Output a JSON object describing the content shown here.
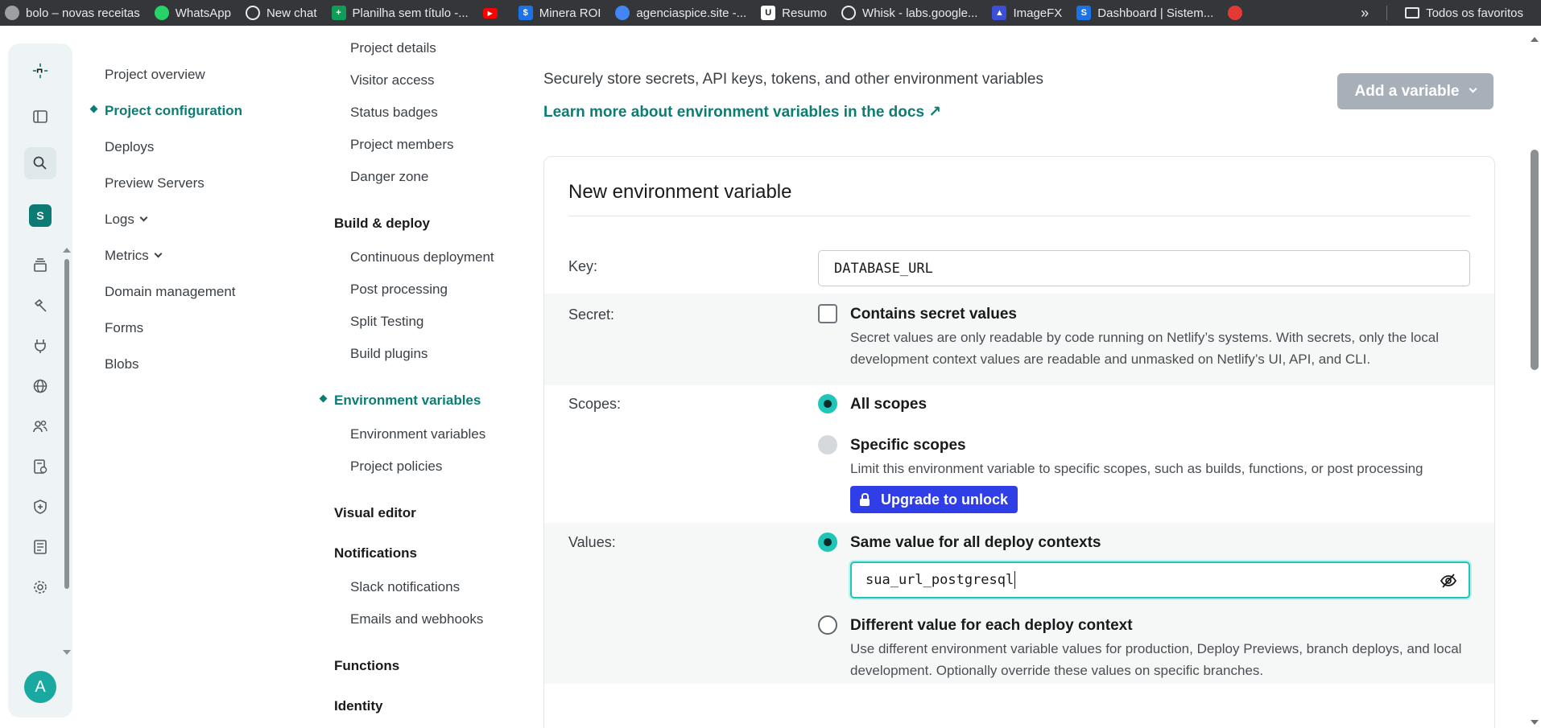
{
  "bookmarks": [
    {
      "label": "bolo – novas receitas",
      "icon": "globe-icon",
      "color": "#9aa0a6"
    },
    {
      "label": "WhatsApp",
      "icon": "whatsapp-icon",
      "color": "#25d366"
    },
    {
      "label": "New chat",
      "icon": "openai-icon",
      "color": "#35363a"
    },
    {
      "label": "Planilha sem título -...",
      "icon": "sheets-icon",
      "color": "#0f9d58"
    },
    {
      "label": "",
      "icon": "youtube-icon",
      "color": "#ff0000"
    },
    {
      "label": "Minera ROI",
      "icon": "minera-icon",
      "color": "#1a73e8"
    },
    {
      "label": "agenciaspice.site -...",
      "icon": "site-icon",
      "color": "#4285f4"
    },
    {
      "label": "Resumo",
      "icon": "resumo-icon",
      "color": "#202124"
    },
    {
      "label": "Whisk - labs.google...",
      "icon": "whisk-icon",
      "color": "#35363a"
    },
    {
      "label": "ImageFX",
      "icon": "imagefx-icon",
      "color": "#3c4fd8"
    },
    {
      "label": "Dashboard | Sistem...",
      "icon": "dashboard-icon",
      "color": "#1a73e8"
    },
    {
      "label": "",
      "icon": "app-icon",
      "color": "#e53935"
    }
  ],
  "bookmarks_folder": "Todos os favoritos",
  "rail": {
    "team_initial": "S",
    "avatar_initial": "A"
  },
  "nav1": {
    "items": [
      {
        "label": "Project overview"
      },
      {
        "label": "Project configuration"
      },
      {
        "label": "Deploys"
      },
      {
        "label": "Preview Servers"
      },
      {
        "label": "Logs"
      },
      {
        "label": "Metrics"
      },
      {
        "label": "Domain management"
      },
      {
        "label": "Forms"
      },
      {
        "label": "Blobs"
      }
    ]
  },
  "nav2": {
    "general_items": [
      "Project details",
      "Visitor access",
      "Status badges",
      "Project members",
      "Danger zone"
    ],
    "build_deploy": "Build & deploy",
    "build_items": [
      "Continuous deployment",
      "Post processing",
      "Split Testing",
      "Build plugins"
    ],
    "env_vars": "Environment variables",
    "env_items": [
      "Environment variables",
      "Project policies"
    ],
    "visual_editor": "Visual editor",
    "notifications": "Notifications",
    "notification_items": [
      "Slack notifications",
      "Emails and webhooks"
    ],
    "functions": "Functions",
    "identity": "Identity"
  },
  "main": {
    "intro": "Securely store secrets, API keys, tokens, and other environment variables",
    "learn_link": "Learn more about environment variables in the docs ↗",
    "add_variable": "Add a variable",
    "card_title": "New environment variable",
    "key_label": "Key:",
    "key_value": "DATABASE_URL",
    "secret_label": "Secret:",
    "secret_option": "Contains secret values",
    "secret_desc": "Secret values are only readable by code running on Netlify’s systems. With secrets, only the local development context values are readable and unmasked on Netlify’s UI, API, and CLI.",
    "scopes_label": "Scopes:",
    "all_scopes": "All scopes",
    "specific_scopes": "Specific scopes",
    "specific_desc": "Limit this environment variable to specific scopes, such as builds, functions, or post processing",
    "upgrade": "Upgrade to unlock",
    "values_label": "Values:",
    "same_value": "Same value for all deploy contexts",
    "value_input": "sua_url_postgresql",
    "different_value": "Different value for each deploy context",
    "different_desc": "Use different environment variable values for production, Deploy Previews, branch deploys, and local development. Optionally override these values on specific branches."
  },
  "colors": {
    "accent": "#0b7d75",
    "radio_on": "#1fc6b8",
    "upgrade": "#2f3ee6",
    "add_variable_disabled": "#a7b0b8"
  }
}
